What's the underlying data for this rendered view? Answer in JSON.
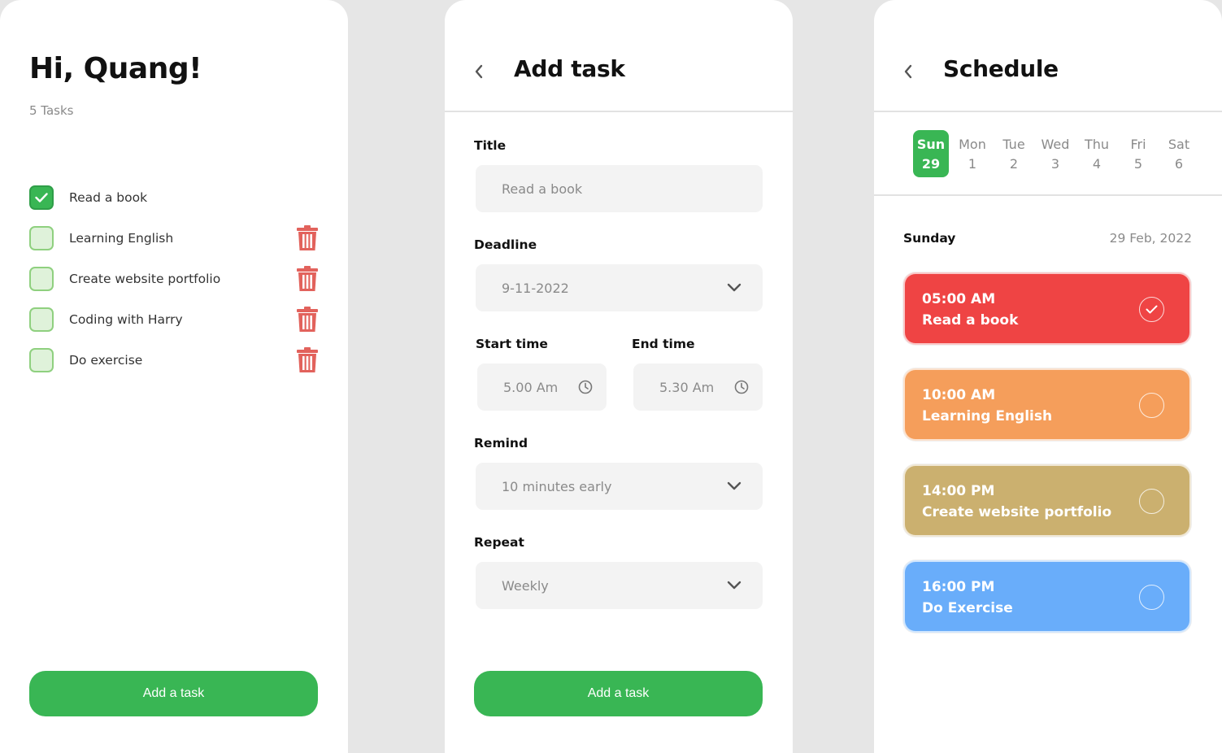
{
  "home": {
    "greeting": "Hi, Quang!",
    "task_count": "5 Tasks",
    "tasks": [
      {
        "label": "Read a book",
        "checked": true
      },
      {
        "label": "Learning English",
        "checked": false
      },
      {
        "label": "Create website portfolio",
        "checked": false
      },
      {
        "label": "Coding with Harry",
        "checked": false
      },
      {
        "label": "Do exercise",
        "checked": false
      }
    ],
    "add_button": "Add a task"
  },
  "add_task": {
    "title": "Add task",
    "fields": {
      "title_label": "Title",
      "title_value": "Read a book",
      "deadline_label": "Deadline",
      "deadline_value": "9-11-2022",
      "start_label": "Start time",
      "start_value": "5.00 Am",
      "end_label": "End time",
      "end_value": "5.30 Am",
      "remind_label": "Remind",
      "remind_value": "10 minutes early",
      "repeat_label": "Repeat",
      "repeat_value": "Weekly"
    },
    "add_button": "Add a task"
  },
  "schedule": {
    "title": "Schedule",
    "days": [
      {
        "name": "Sun",
        "date": "29",
        "active": true
      },
      {
        "name": "Mon",
        "date": "1",
        "active": false
      },
      {
        "name": "Tue",
        "date": "2",
        "active": false
      },
      {
        "name": "Wed",
        "date": "3",
        "active": false
      },
      {
        "name": "Thu",
        "date": "4",
        "active": false
      },
      {
        "name": "Fri",
        "date": "5",
        "active": false
      },
      {
        "name": "Sat",
        "date": "6",
        "active": false
      }
    ],
    "selected_day": "Sunday",
    "selected_date": "29 Feb, 2022",
    "items": [
      {
        "time": "05:00 AM",
        "name": "Read a book",
        "done": true,
        "color": "#ef4444"
      },
      {
        "time": "10:00 AM",
        "name": "Learning English",
        "done": false,
        "color": "#f59e5b"
      },
      {
        "time": "14:00 PM",
        "name": "Create website portfolio",
        "done": false,
        "color": "#cbb06f"
      },
      {
        "time": "16:00 PM",
        "name": "Do Exercise",
        "done": false,
        "color": "#69adfa"
      }
    ]
  },
  "colors": {
    "accent": "#39b654",
    "trash": "#e2625c",
    "muted_text": "#8a8a8a",
    "field_bg": "#f3f3f3"
  },
  "icons": {
    "check": "check-icon",
    "trash": "trash-icon",
    "back": "chevron-left-icon",
    "dropdown": "chevron-down-icon",
    "clock": "clock-icon",
    "status": "circle-icon"
  }
}
